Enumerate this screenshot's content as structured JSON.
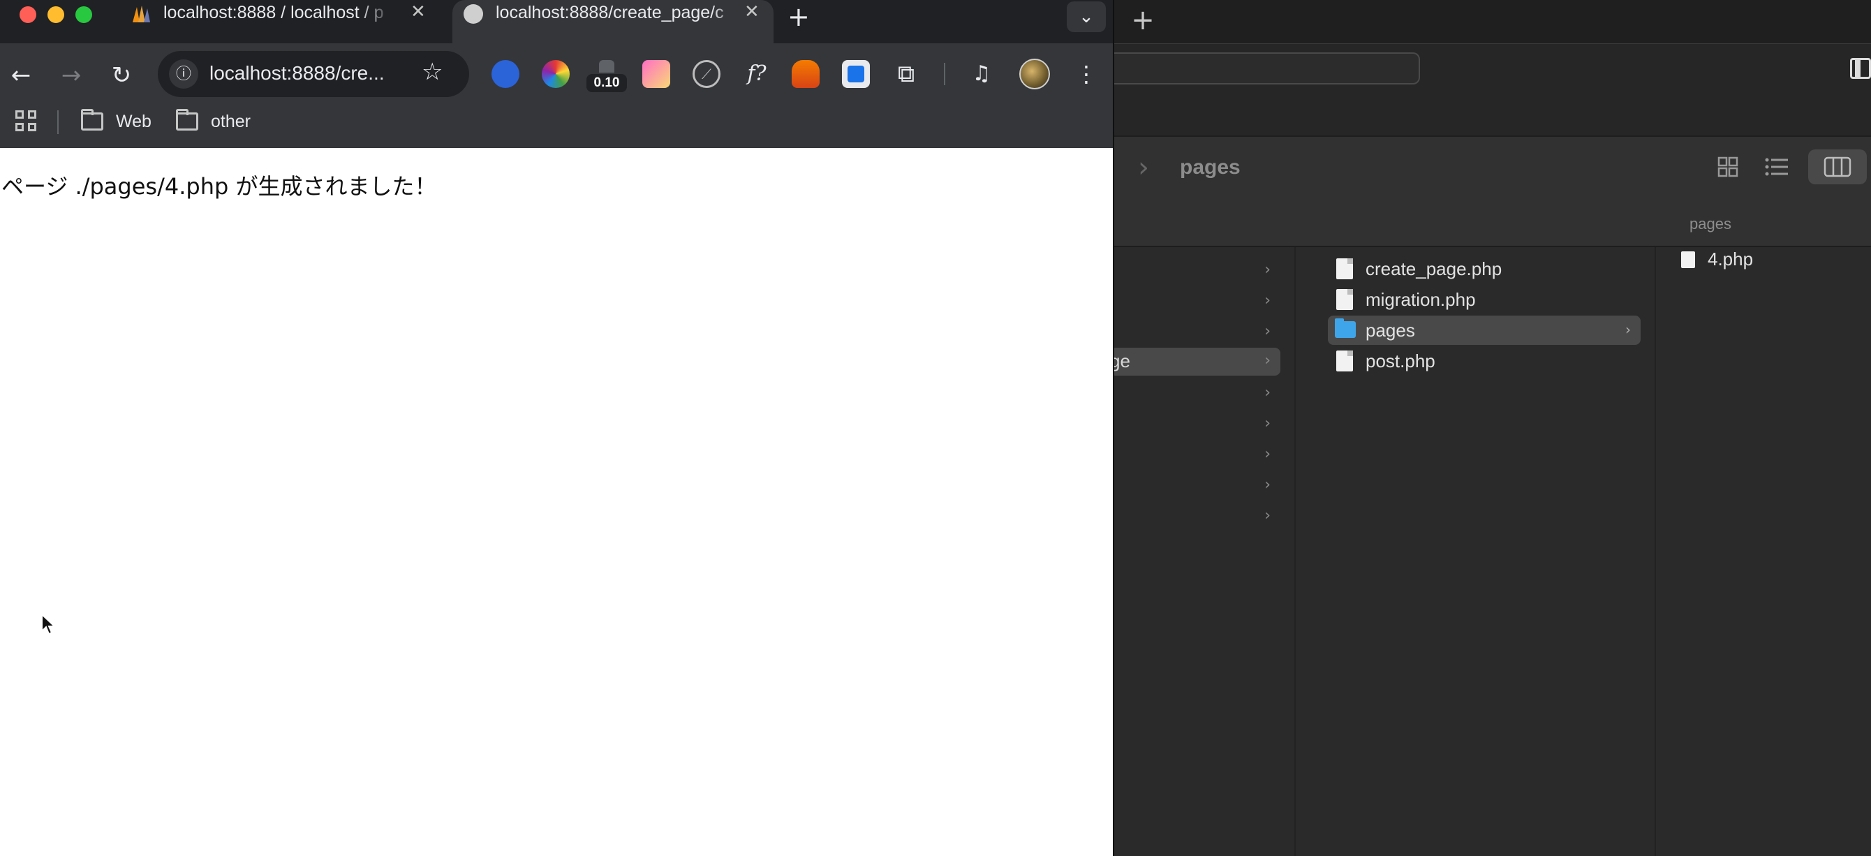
{
  "browser": {
    "tabs": [
      {
        "title": "localhost:8888 / localhost / p",
        "active": false
      },
      {
        "title": "localhost:8888/create_page/c",
        "active": true
      }
    ],
    "new_tab": "+",
    "tab_search": "⌄",
    "address": "localhost:8888/cre...",
    "extension_badge": "0.10",
    "bookmarks": [
      "Web",
      "other"
    ]
  },
  "page": {
    "message": "ページ ./pages/4.php が生成されました！"
  },
  "finder": {
    "new_tab": "+",
    "title": "pages",
    "path_label": "pages",
    "sidebar_partial_label": "ge",
    "files": [
      {
        "name": "create_page.php",
        "kind": "file"
      },
      {
        "name": "migration.php",
        "kind": "file"
      },
      {
        "name": "pages",
        "kind": "folder"
      },
      {
        "name": "post.php",
        "kind": "file"
      }
    ],
    "subfolder_files": [
      {
        "name": "4.php"
      }
    ]
  },
  "colors": {
    "tab_bar": "#202124",
    "toolbar": "#35363a",
    "folder_blue": "#3fa5ea",
    "selection": "#4a4949"
  }
}
